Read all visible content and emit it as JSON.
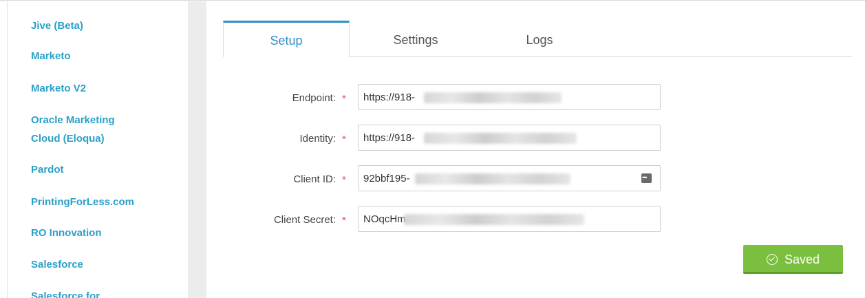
{
  "sidebar": {
    "items": [
      {
        "label": "Jive (Beta)"
      },
      {
        "label": "Marketo"
      },
      {
        "label": "Marketo V2"
      },
      {
        "label": "Oracle Marketing Cloud (Eloqua)"
      },
      {
        "label": "Pardot"
      },
      {
        "label": "PrintingForLess.com"
      },
      {
        "label": "RO Innovation"
      },
      {
        "label": "Salesforce"
      },
      {
        "label": "Salesforce for"
      }
    ]
  },
  "tabs": [
    {
      "label": "Setup",
      "active": true
    },
    {
      "label": "Settings",
      "active": false
    },
    {
      "label": "Logs",
      "active": false
    }
  ],
  "form": {
    "endpoint": {
      "label": "Endpoint:",
      "value": "https://918-"
    },
    "identity": {
      "label": "Identity:",
      "value": "https://918-"
    },
    "client_id": {
      "label": "Client ID:",
      "value": "92bbf195-"
    },
    "client_secret": {
      "label": "Client Secret:",
      "value": "NOqcHm"
    },
    "required_marker": "*"
  },
  "save_button": {
    "label": "Saved",
    "icon": "check-circle-icon"
  },
  "colors": {
    "link": "#2aa0c8",
    "accent": "#2e8fc7",
    "success": "#7bbf3e",
    "required": "#e05252"
  }
}
